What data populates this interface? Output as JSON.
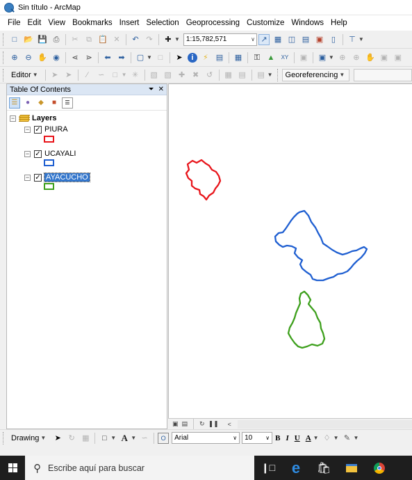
{
  "window": {
    "title": "Sin título - ArcMap",
    "icon": "arcmap-globe-icon"
  },
  "menu": [
    "File",
    "Edit",
    "View",
    "Bookmarks",
    "Insert",
    "Selection",
    "Geoprocessing",
    "Customize",
    "Windows",
    "Help"
  ],
  "standard_toolbar": {
    "scale_value": "1:15,782,571"
  },
  "editor_toolbar": {
    "editor_label": "Editor",
    "georeferencing_label": "Georeferencing"
  },
  "toc": {
    "title": "Table Of Contents",
    "pin_icon": "pin-icon",
    "close_icon": "close-icon",
    "root_label": "Layers",
    "layers": [
      {
        "name": "PIURA",
        "checked": true,
        "color": "#e8151b",
        "selected": false
      },
      {
        "name": "UCAYALI",
        "checked": true,
        "color": "#1f5fd1",
        "selected": false
      },
      {
        "name": "AYACUCHO",
        "checked": true,
        "color": "#3ea01d",
        "selected": true
      }
    ]
  },
  "drawing_toolbar": {
    "drawing_label": "Drawing",
    "font_name": "Arial",
    "font_size": "10",
    "bold": "B",
    "italic": "I",
    "underline": "U",
    "font_color_letter": "A"
  },
  "taskbar": {
    "search_placeholder": "Escribe aquí para buscar"
  }
}
